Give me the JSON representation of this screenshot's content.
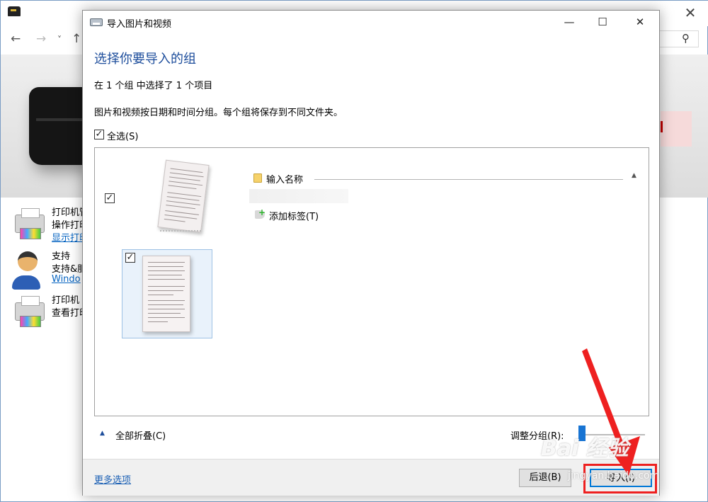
{
  "background": {
    "search_icon": "magnifier-icon",
    "nav": {
      "back": "←",
      "forward": "→",
      "dropdown": "˅",
      "up": "↑"
    },
    "items": [
      {
        "title": "打印机管",
        "subtitle": "操作打印",
        "link": "显示打印"
      },
      {
        "title": "支持",
        "subtitle": "支持&服",
        "link": "Windo"
      },
      {
        "title": "打印机",
        "subtitle": "查看打印",
        "link": ""
      }
    ]
  },
  "dialog": {
    "title": "导入图片和视频",
    "controls": {
      "minimize": "—",
      "maximize": "☐",
      "close": "✕"
    },
    "heading": "选择你要导入的组",
    "summary": "在 1 个组 中选择了 1 个项目",
    "description": "图片和视频按日期和时间分组。每个组将保存到不同文件夹。",
    "select_all": {
      "label": "全选(S)",
      "checked": true
    },
    "groups": [
      {
        "name": "输入名称",
        "checked": true,
        "add_tag": "添加标签(T)",
        "items": [
          {
            "checked": true
          }
        ]
      }
    ],
    "collapse_all": "全部折叠(C)",
    "adjust_grouping": "调整分组(R):",
    "more_options": "更多选项",
    "buttons": {
      "back": "后退(B)",
      "import": "导入(I)"
    }
  },
  "overlay": {
    "watermark_logo": "Bai 经验",
    "watermark_url": "jingyan.baidu.com",
    "accent_color": "#ee2020"
  }
}
